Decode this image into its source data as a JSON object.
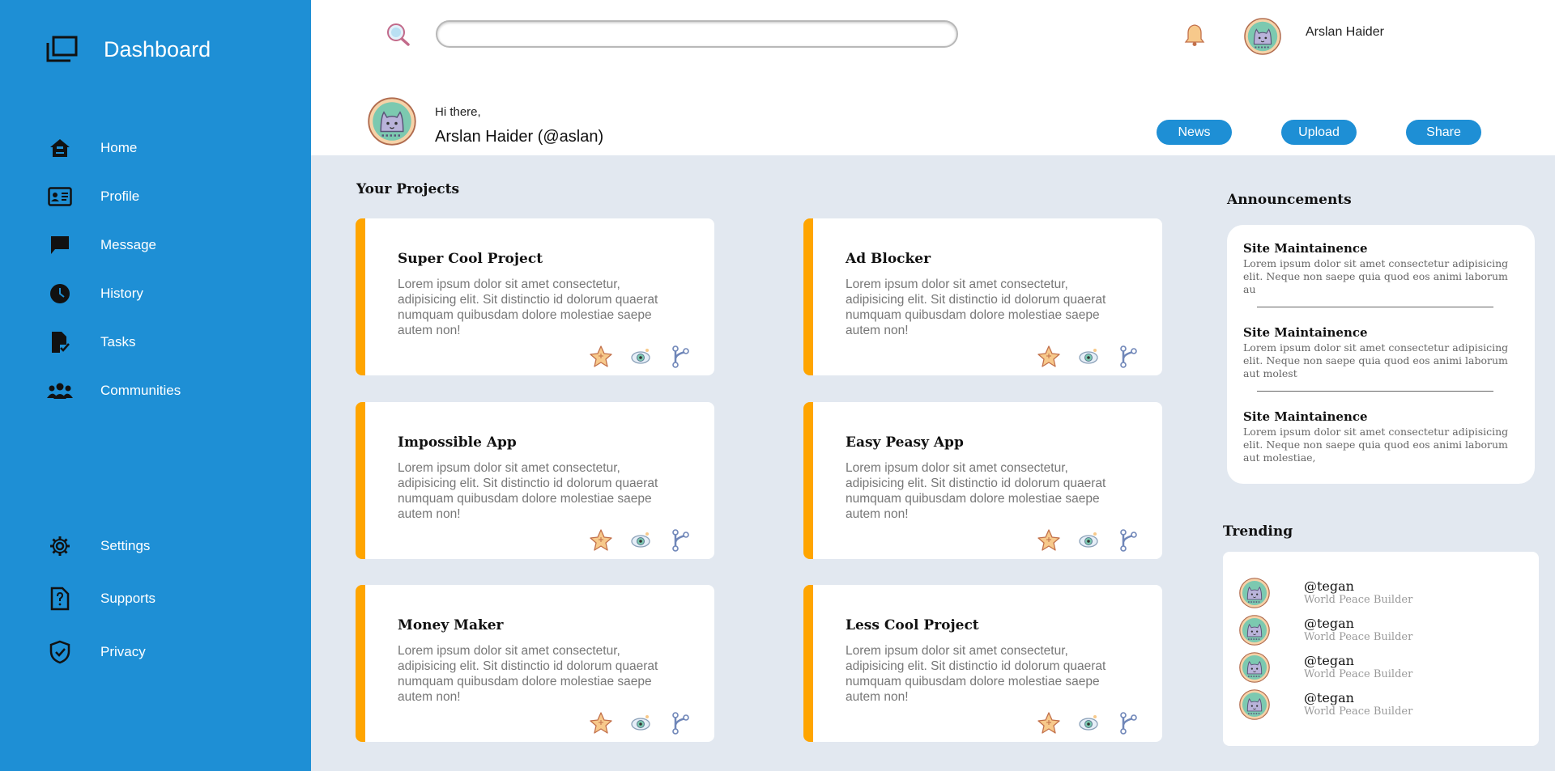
{
  "sidebar": {
    "brand": "Dashboard",
    "brand_icon": "stacked-windows-icon",
    "nav": [
      {
        "label": "Home",
        "icon": "home-icon"
      },
      {
        "label": "Profile",
        "icon": "id-card-icon"
      },
      {
        "label": "Message",
        "icon": "chat-icon"
      },
      {
        "label": "History",
        "icon": "clock-icon"
      },
      {
        "label": "Tasks",
        "icon": "file-check-icon"
      },
      {
        "label": "Communities",
        "icon": "people-icon"
      }
    ],
    "bottom_nav": [
      {
        "label": "Settings",
        "icon": "gear-icon"
      },
      {
        "label": "Supports",
        "icon": "help-file-icon"
      },
      {
        "label": "Privacy",
        "icon": "shield-icon"
      }
    ]
  },
  "header": {
    "search_value": "",
    "user_name": "Arslan Haider",
    "greeting": "Hi there,",
    "user_full": "Arslan Haider (@aslan)",
    "buttons": [
      "News",
      "Upload",
      "Share"
    ]
  },
  "projects": {
    "title": "Your Projects",
    "items": [
      {
        "title": "Super Cool Project",
        "desc": "Lorem ipsum dolor sit amet consectetur, adipisicing elit. Sit distinctio id dolorum quaerat numquam quibusdam dolore molestiae saepe autem non!"
      },
      {
        "title": "Ad Blocker",
        "desc": "Lorem ipsum dolor sit amet consectetur, adipisicing elit. Sit distinctio id dolorum quaerat numquam quibusdam dolore molestiae saepe autem non!"
      },
      {
        "title": "Impossible App",
        "desc": "Lorem ipsum dolor sit amet consectetur, adipisicing elit. Sit distinctio id dolorum quaerat numquam quibusdam dolore molestiae saepe autem non!"
      },
      {
        "title": "Easy Peasy App",
        "desc": "Lorem ipsum dolor sit amet consectetur, adipisicing elit. Sit distinctio id dolorum quaerat numquam quibusdam dolore molestiae saepe autem non!"
      },
      {
        "title": "Money Maker",
        "desc": "Lorem ipsum dolor sit amet consectetur, adipisicing elit. Sit distinctio id dolorum quaerat numquam quibusdam dolore molestiae saepe autem non!"
      },
      {
        "title": "Less Cool Project",
        "desc": "Lorem ipsum dolor sit amet consectetur, adipisicing elit. Sit distinctio id dolorum quaerat numquam quibusdam dolore molestiae saepe autem non!"
      }
    ],
    "card_icons": [
      "star-icon",
      "eye-icon",
      "git-branch-icon"
    ]
  },
  "announcements": {
    "title": "Announcements",
    "items": [
      {
        "title": "Site Maintainence",
        "text": "Lorem ipsum dolor sit amet consectetur adipisicing elit. Neque non saepe quia quod eos animi laborum au"
      },
      {
        "title": "Site Maintainence",
        "text": "Lorem ipsum dolor sit amet consectetur adipisicing elit. Neque non saepe quia quod eos animi laborum aut molest"
      },
      {
        "title": "Site Maintainence",
        "text": "Lorem ipsum dolor sit amet consectetur adipisicing elit. Neque non saepe quia quod eos animi laborum aut molestiae,"
      }
    ]
  },
  "trending": {
    "title": "Trending",
    "items": [
      {
        "handle": "@tegan",
        "role": "World Peace Builder"
      },
      {
        "handle": "@tegan",
        "role": "World Peace Builder"
      },
      {
        "handle": "@tegan",
        "role": "World Peace Builder"
      },
      {
        "handle": "@tegan",
        "role": "World Peace Builder"
      }
    ]
  },
  "colors": {
    "sidebar": "#1e8fd5",
    "accent": "#ffa500",
    "background": "#e2e8f0"
  }
}
